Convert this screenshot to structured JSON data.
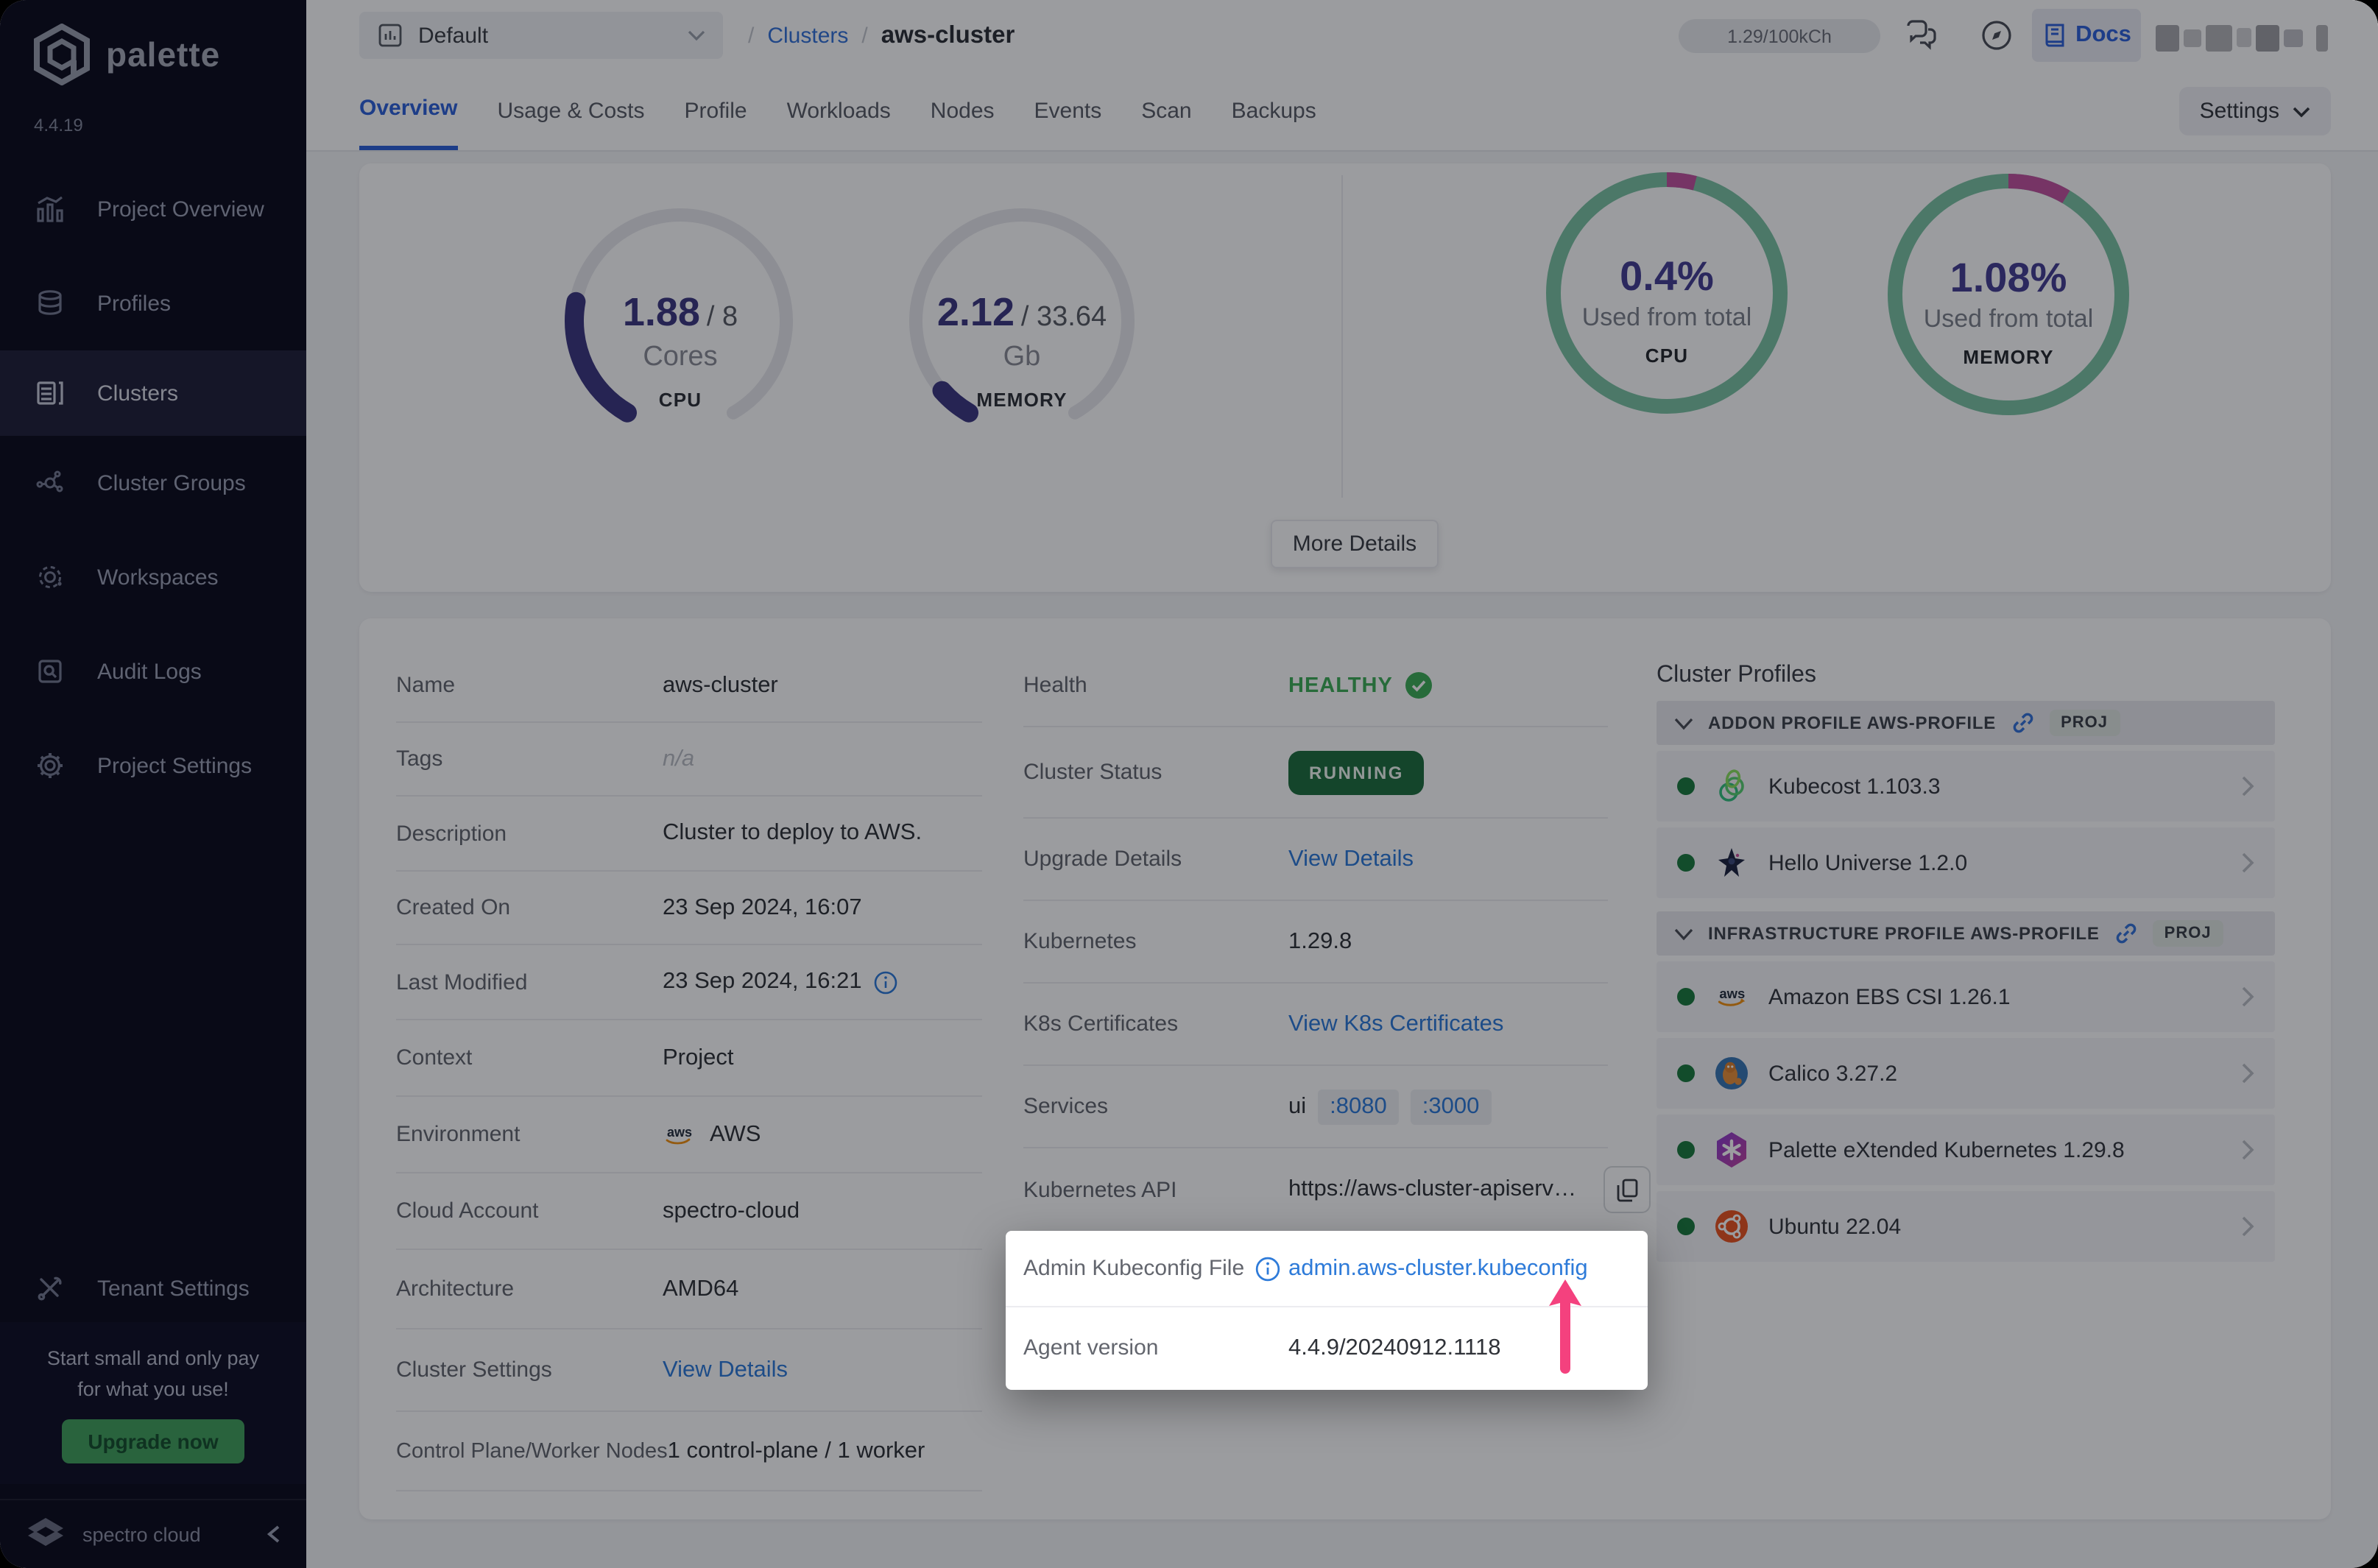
{
  "app": {
    "name": "palette",
    "version": "4.4.19"
  },
  "colors": {
    "accent_blue": "#2e62d9",
    "link_blue": "#2e7bd9",
    "indigo_value": "#453f93",
    "gauge_purple": "#3d3780",
    "gauge_track": "#e8e8ed",
    "ring_green": "#7cc3a4",
    "ring_pink": "#c2539e",
    "healthy_green": "#3fae57",
    "running_bg": "#1e6f3e",
    "arrow_pink": "#f4417e",
    "sidebar_bg": "#0c0c1d",
    "upgrade_green": "#42a05c"
  },
  "sidebar": {
    "items": [
      {
        "label": "Project Overview"
      },
      {
        "label": "Profiles"
      },
      {
        "label": "Clusters"
      },
      {
        "label": "Cluster Groups"
      },
      {
        "label": "Workspaces"
      },
      {
        "label": "Audit Logs"
      },
      {
        "label": "Project Settings"
      },
      {
        "label": "Tenant Settings"
      }
    ],
    "promo": {
      "line1": "Start small and only pay",
      "line2": "for what you use!",
      "button": "Upgrade now"
    },
    "brand": "spectro cloud"
  },
  "topbar": {
    "project_selector": "Default",
    "breadcrumb": {
      "sep": "/",
      "parent": "Clusters",
      "current": "aws-cluster"
    },
    "credits": "1.29/100kCh",
    "docs_label": "Docs"
  },
  "tabs": {
    "items": [
      "Overview",
      "Usage & Costs",
      "Profile",
      "Workloads",
      "Nodes",
      "Events",
      "Scan",
      "Backups"
    ],
    "settings_button": "Settings"
  },
  "overview": {
    "gauges": [
      {
        "value": "1.88",
        "total": "/ 8",
        "unit": "Cores",
        "label": "CPU",
        "fraction": 0.235
      },
      {
        "value": "2.12",
        "total": "/ 33.64",
        "unit": "Gb",
        "label": "MEMORY",
        "fraction": 0.063
      }
    ],
    "rings": [
      {
        "percent": "0.4%",
        "caption": "Used from total",
        "label": "CPU",
        "fraction": 0.04
      },
      {
        "percent": "1.08%",
        "caption": "Used from total",
        "label": "MEMORY",
        "fraction": 0.085
      }
    ],
    "more_details": "More Details"
  },
  "details": {
    "left": [
      {
        "label": "Name",
        "value": "aws-cluster"
      },
      {
        "label": "Tags",
        "value": "n/a"
      },
      {
        "label": "Description",
        "value": "Cluster to deploy to AWS."
      },
      {
        "label": "Created On",
        "value": "23 Sep 2024, 16:07"
      },
      {
        "label": "Last Modified",
        "value": "23 Sep 2024, 16:21"
      },
      {
        "label": "Context",
        "value": "Project"
      },
      {
        "label": "Environment",
        "value": "AWS"
      },
      {
        "label": "Cloud Account",
        "value": "spectro-cloud"
      },
      {
        "label": "Architecture",
        "value": "AMD64"
      },
      {
        "label": "Cluster Settings",
        "value": "View Details"
      },
      {
        "label": "Control Plane/Worker Nodes",
        "value": "1 control-plane / 1 worker"
      }
    ],
    "right": [
      {
        "label": "Health",
        "value": "HEALTHY"
      },
      {
        "label": "Cluster Status",
        "value": "RUNNING"
      },
      {
        "label": "Upgrade Details",
        "value": "View Details"
      },
      {
        "label": "Kubernetes",
        "value": "1.29.8"
      },
      {
        "label": "K8s Certificates",
        "value": "View K8s Certificates"
      },
      {
        "label": "Services",
        "value": "ui",
        "port1": ":8080",
        "port2": ":3000"
      },
      {
        "label": "Kubernetes API",
        "value": "https://aws-cluster-apiserve..."
      }
    ]
  },
  "highlight": {
    "kubeconfig": {
      "label": "Admin Kubeconfig File",
      "value": "admin.aws-cluster.kubeconfig"
    },
    "agent": {
      "label": "Agent version",
      "value": "4.4.9/20240912.1118"
    }
  },
  "cluster_profiles": {
    "title": "Cluster Profiles",
    "sections": [
      {
        "header": "ADDON PROFILE AWS-PROFILE",
        "badge": "PROJ",
        "items": [
          {
            "name": "Kubecost 1.103.3"
          },
          {
            "name": "Hello Universe 1.2.0"
          }
        ]
      },
      {
        "header": "INFRASTRUCTURE PROFILE AWS-PROFILE",
        "badge": "PROJ",
        "items": [
          {
            "name": "Amazon EBS CSI 1.26.1"
          },
          {
            "name": "Calico 3.27.2"
          },
          {
            "name": "Palette eXtended Kubernetes 1.29.8"
          },
          {
            "name": "Ubuntu 22.04"
          }
        ]
      }
    ]
  }
}
